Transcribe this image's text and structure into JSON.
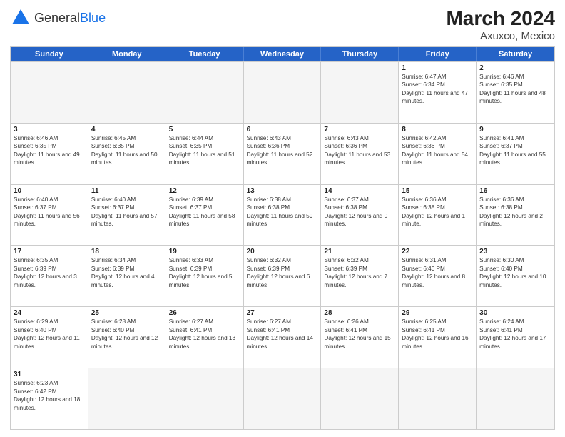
{
  "header": {
    "logo_general": "General",
    "logo_blue": "Blue",
    "title": "March 2024",
    "subtitle": "Axuxco, Mexico"
  },
  "weekdays": [
    "Sunday",
    "Monday",
    "Tuesday",
    "Wednesday",
    "Thursday",
    "Friday",
    "Saturday"
  ],
  "rows": [
    [
      {
        "day": "",
        "empty": true
      },
      {
        "day": "",
        "empty": true
      },
      {
        "day": "",
        "empty": true
      },
      {
        "day": "",
        "empty": true
      },
      {
        "day": "",
        "empty": true
      },
      {
        "day": "1",
        "sunrise": "6:47 AM",
        "sunset": "6:34 PM",
        "daylight": "11 hours and 47 minutes."
      },
      {
        "day": "2",
        "sunrise": "6:46 AM",
        "sunset": "6:35 PM",
        "daylight": "11 hours and 48 minutes."
      }
    ],
    [
      {
        "day": "3",
        "sunrise": "6:46 AM",
        "sunset": "6:35 PM",
        "daylight": "11 hours and 49 minutes."
      },
      {
        "day": "4",
        "sunrise": "6:45 AM",
        "sunset": "6:35 PM",
        "daylight": "11 hours and 50 minutes."
      },
      {
        "day": "5",
        "sunrise": "6:44 AM",
        "sunset": "6:35 PM",
        "daylight": "11 hours and 51 minutes."
      },
      {
        "day": "6",
        "sunrise": "6:43 AM",
        "sunset": "6:36 PM",
        "daylight": "11 hours and 52 minutes."
      },
      {
        "day": "7",
        "sunrise": "6:43 AM",
        "sunset": "6:36 PM",
        "daylight": "11 hours and 53 minutes."
      },
      {
        "day": "8",
        "sunrise": "6:42 AM",
        "sunset": "6:36 PM",
        "daylight": "11 hours and 54 minutes."
      },
      {
        "day": "9",
        "sunrise": "6:41 AM",
        "sunset": "6:37 PM",
        "daylight": "11 hours and 55 minutes."
      }
    ],
    [
      {
        "day": "10",
        "sunrise": "6:40 AM",
        "sunset": "6:37 PM",
        "daylight": "11 hours and 56 minutes."
      },
      {
        "day": "11",
        "sunrise": "6:40 AM",
        "sunset": "6:37 PM",
        "daylight": "11 hours and 57 minutes."
      },
      {
        "day": "12",
        "sunrise": "6:39 AM",
        "sunset": "6:37 PM",
        "daylight": "11 hours and 58 minutes."
      },
      {
        "day": "13",
        "sunrise": "6:38 AM",
        "sunset": "6:38 PM",
        "daylight": "11 hours and 59 minutes."
      },
      {
        "day": "14",
        "sunrise": "6:37 AM",
        "sunset": "6:38 PM",
        "daylight": "12 hours and 0 minutes."
      },
      {
        "day": "15",
        "sunrise": "6:36 AM",
        "sunset": "6:38 PM",
        "daylight": "12 hours and 1 minute."
      },
      {
        "day": "16",
        "sunrise": "6:36 AM",
        "sunset": "6:38 PM",
        "daylight": "12 hours and 2 minutes."
      }
    ],
    [
      {
        "day": "17",
        "sunrise": "6:35 AM",
        "sunset": "6:39 PM",
        "daylight": "12 hours and 3 minutes."
      },
      {
        "day": "18",
        "sunrise": "6:34 AM",
        "sunset": "6:39 PM",
        "daylight": "12 hours and 4 minutes."
      },
      {
        "day": "19",
        "sunrise": "6:33 AM",
        "sunset": "6:39 PM",
        "daylight": "12 hours and 5 minutes."
      },
      {
        "day": "20",
        "sunrise": "6:32 AM",
        "sunset": "6:39 PM",
        "daylight": "12 hours and 6 minutes."
      },
      {
        "day": "21",
        "sunrise": "6:32 AM",
        "sunset": "6:39 PM",
        "daylight": "12 hours and 7 minutes."
      },
      {
        "day": "22",
        "sunrise": "6:31 AM",
        "sunset": "6:40 PM",
        "daylight": "12 hours and 8 minutes."
      },
      {
        "day": "23",
        "sunrise": "6:30 AM",
        "sunset": "6:40 PM",
        "daylight": "12 hours and 10 minutes."
      }
    ],
    [
      {
        "day": "24",
        "sunrise": "6:29 AM",
        "sunset": "6:40 PM",
        "daylight": "12 hours and 11 minutes."
      },
      {
        "day": "25",
        "sunrise": "6:28 AM",
        "sunset": "6:40 PM",
        "daylight": "12 hours and 12 minutes."
      },
      {
        "day": "26",
        "sunrise": "6:27 AM",
        "sunset": "6:41 PM",
        "daylight": "12 hours and 13 minutes."
      },
      {
        "day": "27",
        "sunrise": "6:27 AM",
        "sunset": "6:41 PM",
        "daylight": "12 hours and 14 minutes."
      },
      {
        "day": "28",
        "sunrise": "6:26 AM",
        "sunset": "6:41 PM",
        "daylight": "12 hours and 15 minutes."
      },
      {
        "day": "29",
        "sunrise": "6:25 AM",
        "sunset": "6:41 PM",
        "daylight": "12 hours and 16 minutes."
      },
      {
        "day": "30",
        "sunrise": "6:24 AM",
        "sunset": "6:41 PM",
        "daylight": "12 hours and 17 minutes."
      }
    ],
    [
      {
        "day": "31",
        "sunrise": "6:23 AM",
        "sunset": "6:42 PM",
        "daylight": "12 hours and 18 minutes."
      },
      {
        "day": "",
        "empty": true
      },
      {
        "day": "",
        "empty": true
      },
      {
        "day": "",
        "empty": true
      },
      {
        "day": "",
        "empty": true
      },
      {
        "day": "",
        "empty": true
      },
      {
        "day": "",
        "empty": true
      }
    ]
  ]
}
